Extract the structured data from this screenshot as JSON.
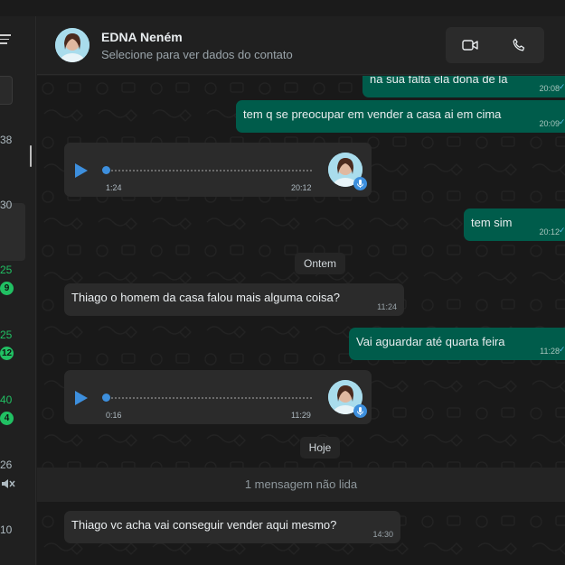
{
  "sidebar": {
    "times": [
      {
        "text": "38",
        "unread": false
      },
      {
        "text": "30",
        "unread": false
      },
      {
        "text": "25",
        "unread": true
      },
      {
        "text": "25",
        "unread": true
      },
      {
        "text": "40",
        "unread": true
      },
      {
        "text": "26",
        "unread": false
      },
      {
        "text": "10",
        "unread": false
      }
    ],
    "badges": [
      "9",
      "12",
      "4"
    ]
  },
  "header": {
    "name": "EDNA Neném",
    "subtitle": "Selecione para ver dados do contato"
  },
  "messages": {
    "m1": {
      "text": "na sua falta ela dona de la",
      "time": "20:08"
    },
    "m2": {
      "text": "tem q se preocupar em vender a casa ai em cima",
      "time": "20:09"
    },
    "audio1": {
      "duration": "1:24",
      "time": "20:12"
    },
    "m3": {
      "text": "tem sim",
      "time": "20:12"
    },
    "day1": "Ontem",
    "m4": {
      "text": "Thiago o homem da casa falou mais alguma coisa?",
      "time": "11:24"
    },
    "m5": {
      "text": "Vai aguardar até quarta feira",
      "time": "11:28"
    },
    "audio2": {
      "duration": "0:16",
      "time": "11:29"
    },
    "day2": "Hoje",
    "unread_notice": "1 mensagem não lida",
    "m6": {
      "text": "Thiago vc acha vai conseguir vender aqui mesmo?",
      "time": "14:30"
    }
  },
  "colors": {
    "outgoing_bubble": "#005c4b",
    "incoming_bubble": "#2b2b2b",
    "accent_blue": "#3d8fdd",
    "unread_green": "#21c063",
    "read_tick": "#53bdeb"
  },
  "icons": [
    "menu-icon",
    "video-call-icon",
    "voice-call-icon",
    "play-icon",
    "microphone-icon",
    "read-receipt-icon",
    "mute-icon"
  ]
}
